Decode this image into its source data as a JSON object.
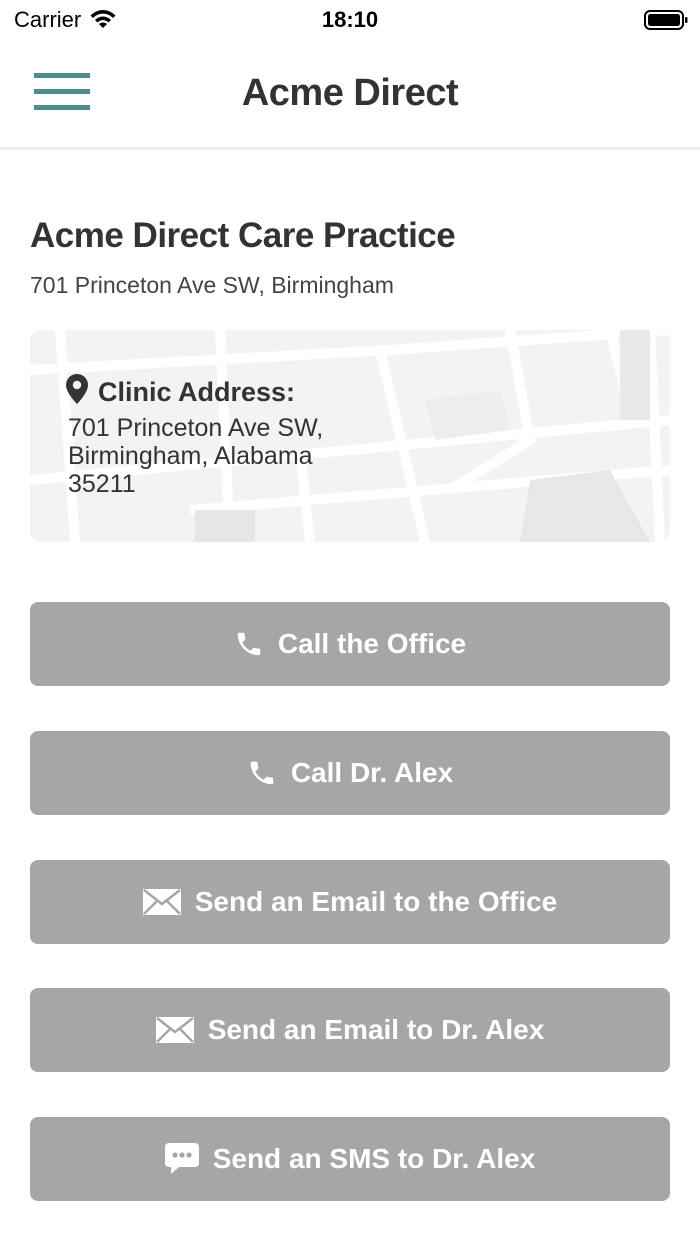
{
  "status_bar": {
    "carrier": "Carrier",
    "time": "18:10"
  },
  "nav": {
    "title": "Acme Direct",
    "accent_color": "#4c8d8b"
  },
  "practice": {
    "name": "Acme Direct Care Practice",
    "address": "701 Princeton Ave SW, Birmingham"
  },
  "map_card": {
    "label": "Clinic Address:",
    "address_line1": "701 Princeton Ave SW,",
    "address_line2": "Birmingham, Alabama",
    "address_line3": "35211",
    "icon": "location-pin-icon"
  },
  "buttons": [
    {
      "label": "Call the Office",
      "icon": "phone-icon"
    },
    {
      "label": "Call Dr. Alex",
      "icon": "phone-icon"
    },
    {
      "label": "Send an Email to the Office",
      "icon": "envelope-icon"
    },
    {
      "label": "Send an Email to Dr. Alex",
      "icon": "envelope-icon"
    },
    {
      "label": "Send an SMS to Dr. Alex",
      "icon": "chat-bubble-icon"
    }
  ],
  "colors": {
    "button_bg": "#a6a6a6",
    "button_text": "#ffffff",
    "text": "#333333"
  }
}
